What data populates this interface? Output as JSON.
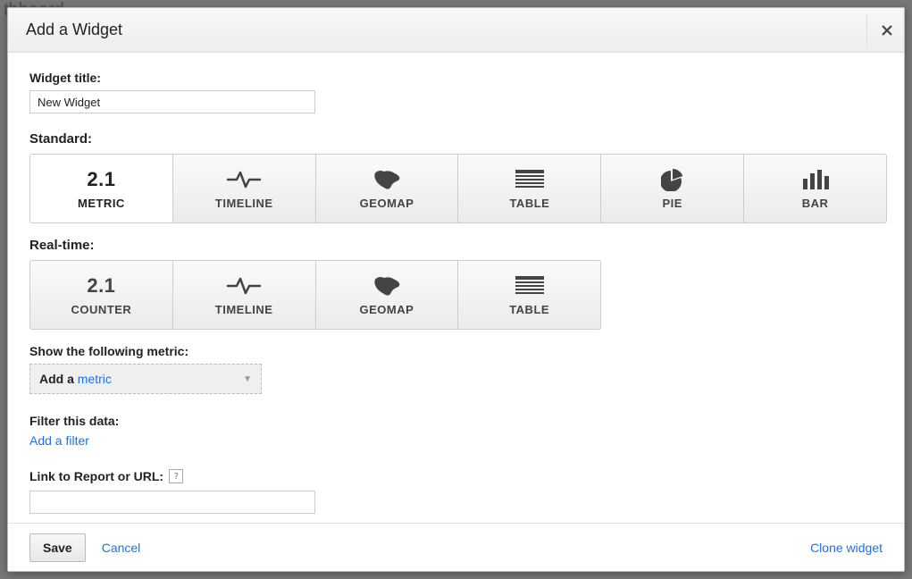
{
  "background_peek": "thboard",
  "modal": {
    "title": "Add a Widget",
    "close_label": "×"
  },
  "widget_title": {
    "label": "Widget title:",
    "value": "New Widget"
  },
  "standard": {
    "label": "Standard:",
    "items": [
      {
        "name": "metric",
        "label": "METRIC",
        "icon": "num",
        "selected": true
      },
      {
        "name": "timeline",
        "label": "TIMELINE",
        "icon": "pulse",
        "selected": false
      },
      {
        "name": "geomap",
        "label": "GEOMAP",
        "icon": "map",
        "selected": false
      },
      {
        "name": "table",
        "label": "TABLE",
        "icon": "table",
        "selected": false
      },
      {
        "name": "pie",
        "label": "PIE",
        "icon": "pie",
        "selected": false
      },
      {
        "name": "bar",
        "label": "BAR",
        "icon": "bar",
        "selected": false
      }
    ]
  },
  "realtime": {
    "label": "Real-time:",
    "items": [
      {
        "name": "counter",
        "label": "COUNTER",
        "icon": "num"
      },
      {
        "name": "timeline",
        "label": "TIMELINE",
        "icon": "pulse"
      },
      {
        "name": "geomap",
        "label": "GEOMAP",
        "icon": "map"
      },
      {
        "name": "table",
        "label": "TABLE",
        "icon": "table"
      }
    ]
  },
  "metric_section": {
    "label": "Show the following metric:",
    "prefix": "Add a ",
    "link": "metric"
  },
  "filter_section": {
    "label": "Filter this data:",
    "link": "Add a filter"
  },
  "link_section": {
    "label": "Link to Report or URL:",
    "value": ""
  },
  "footer": {
    "save": "Save",
    "cancel": "Cancel",
    "clone": "Clone widget"
  },
  "num_icon_text": "2.1"
}
